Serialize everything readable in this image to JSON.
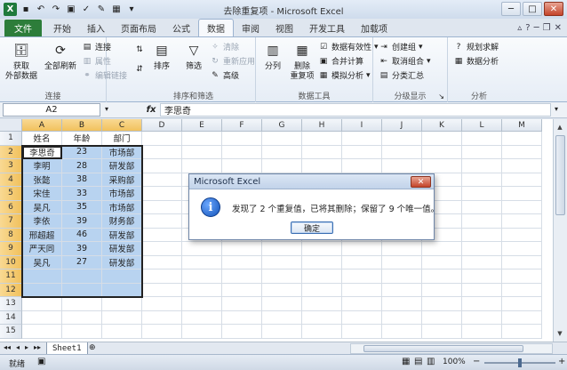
{
  "window": {
    "title": "去除重复项 - Microsoft Excel",
    "min": "─",
    "max": "□",
    "close": "✕"
  },
  "qat": {
    "logo": "X"
  },
  "tabs": [
    "文件",
    "开始",
    "插入",
    "页面布局",
    "公式",
    "数据",
    "审阅",
    "视图",
    "开发工具",
    "加载项"
  ],
  "ribbon": {
    "get_external": "获取\n外部数据",
    "refresh_all": "全部刷新",
    "connections": [
      "连接",
      "属性",
      "编辑链接"
    ],
    "group_connections": "连接",
    "sort": "排序",
    "filter": "筛选",
    "filter_small": [
      "清除",
      "重新应用",
      "高级"
    ],
    "group_sort": "排序和筛选",
    "split": "分列",
    "remove_dup": "删除\n重复项",
    "tools_small": [
      "数据有效性",
      "合并计算",
      "模拟分析"
    ],
    "group_tools": "数据工具",
    "outline_small": [
      "创建组",
      "取消组合",
      "分类汇总"
    ],
    "group_outline": "分级显示",
    "analysis_small": [
      "规划求解",
      "数据分析"
    ],
    "group_analysis": "分析"
  },
  "formula_bar": {
    "name_box": "A2",
    "fx": "fx",
    "content": "李思奇"
  },
  "columns": [
    "A",
    "B",
    "C",
    "D",
    "E",
    "F",
    "G",
    "H",
    "I",
    "J",
    "K",
    "L",
    "M"
  ],
  "rows": [
    "1",
    "2",
    "3",
    "4",
    "5",
    "6",
    "7",
    "8",
    "9",
    "10",
    "11",
    "12",
    "13",
    "14",
    "15"
  ],
  "table": {
    "headers": [
      "姓名",
      "年龄",
      "部门"
    ],
    "rows": [
      [
        "李思奇",
        "23",
        "市场部"
      ],
      [
        "李明",
        "28",
        "研发部"
      ],
      [
        "张懿",
        "38",
        "采购部"
      ],
      [
        "宋佳",
        "33",
        "市场部"
      ],
      [
        "吴凡",
        "35",
        "市场部"
      ],
      [
        "李依",
        "39",
        "财务部"
      ],
      [
        "邢超超",
        "46",
        "研发部"
      ],
      [
        "严天同",
        "39",
        "研发部"
      ],
      [
        "吴凡",
        "27",
        "研发部"
      ]
    ]
  },
  "sheet": {
    "name": "Sheet1"
  },
  "status": {
    "ready": "就绪",
    "zoom": "100%",
    "minus": "−",
    "plus": "+"
  },
  "dialog": {
    "title": "Microsoft Excel",
    "close": "✕",
    "icon": "i",
    "message": "发现了 2 个重复值，已将其删除；保留了 9 个唯一值。",
    "ok": "确定"
  }
}
